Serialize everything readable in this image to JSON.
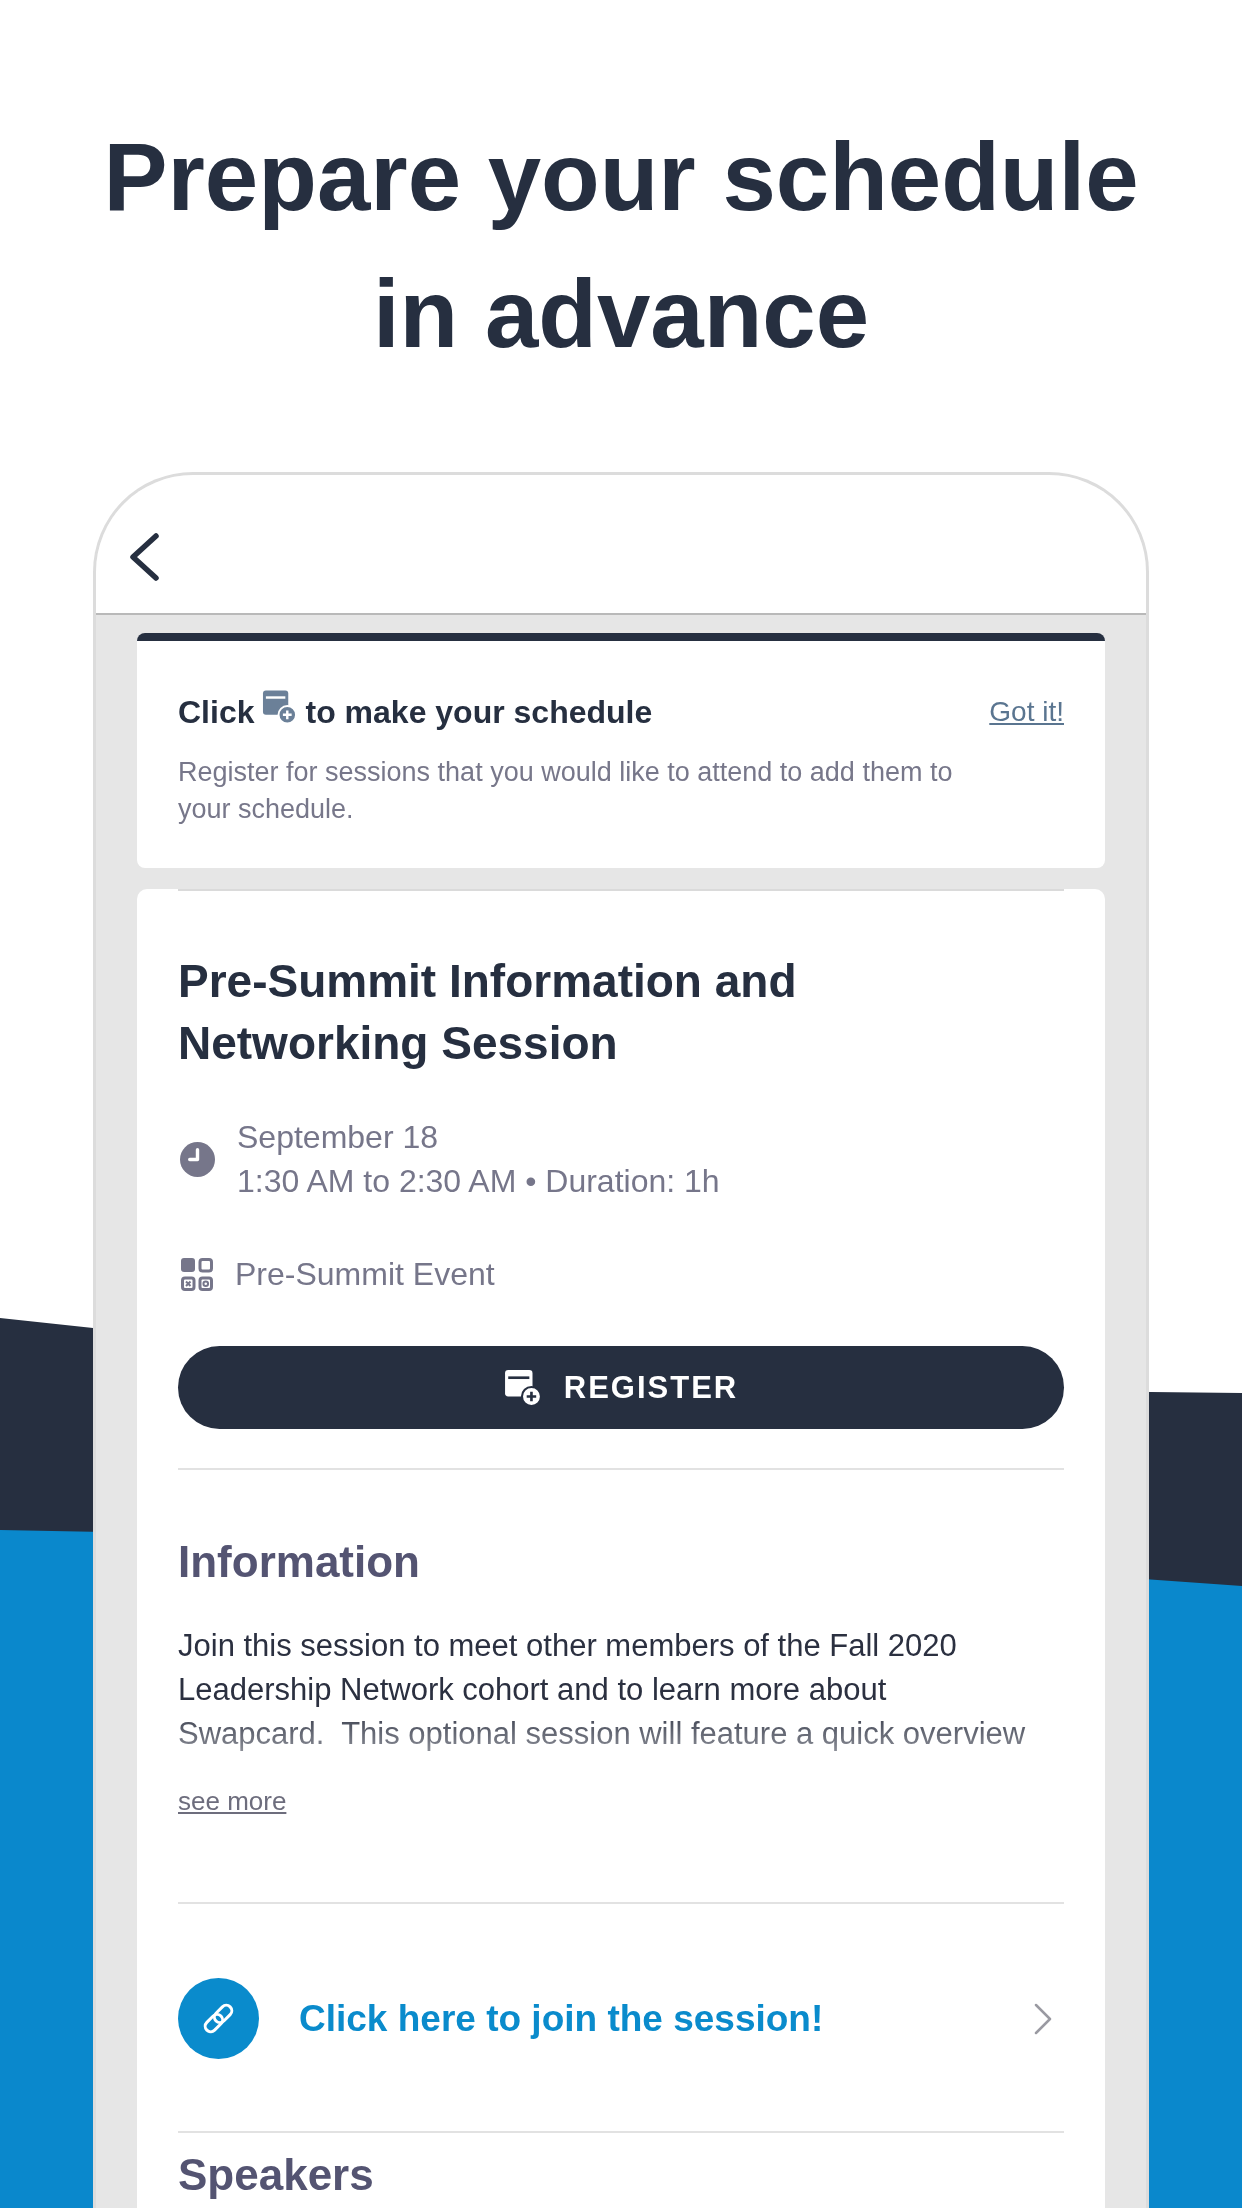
{
  "headline": "Prepare your schedule in advance",
  "screen": {
    "tip": {
      "title_start": "Click",
      "title_end": "to make your schedule",
      "dismiss_link": "Got it!",
      "text": "Register for sessions that you would like to attend to add them to your schedule."
    },
    "session": {
      "title": "Pre-Summit Information and Networking Session",
      "date": "September 18",
      "time": "1:30 AM to 2:30 AM • Duration: 1h",
      "category": "Pre-Summit Event",
      "register_button": "REGISTER",
      "information": {
        "heading": "Information",
        "text": "Join this session to meet other members of the Fall 2020 Leadership Network cohort and to learn more about Swapcard.  This optional session will feature a quick overview",
        "see_more": "see more"
      },
      "join_link": "Click here to join the session!",
      "speakers": {
        "heading": "Speakers"
      }
    }
  }
}
